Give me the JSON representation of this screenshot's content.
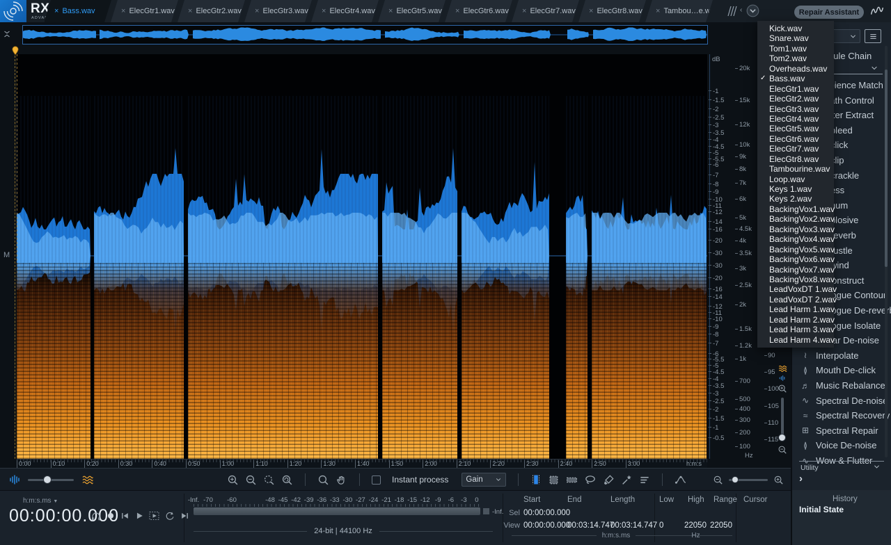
{
  "app": {
    "logo_text": "RX",
    "logo_sub": "ADVANCED",
    "repair_assistant_label": "Repair Assistant"
  },
  "tabs": [
    {
      "label": "Bass.wav",
      "active": true
    },
    {
      "label": "ElecGtr1.wav",
      "active": false
    },
    {
      "label": "ElecGtr2.wav",
      "active": false
    },
    {
      "label": "ElecGtr3.wav",
      "active": false
    },
    {
      "label": "ElecGtr4.wav",
      "active": false
    },
    {
      "label": "ElecGtr5.wav",
      "active": false
    },
    {
      "label": "ElecGtr6.wav",
      "active": false
    },
    {
      "label": "ElecGtr7.wav",
      "active": false
    },
    {
      "label": "ElecGtr8.wav",
      "active": false
    },
    {
      "label": "Tambou…e.wav",
      "active": false
    }
  ],
  "file_menu": {
    "selected": "Bass.wav",
    "items": [
      "Kick.wav",
      "Snare.wav",
      "Tom1.wav",
      "Tom2.wav",
      "Overheads.wav",
      "Bass.wav",
      "ElecGtr1.wav",
      "ElecGtr2.wav",
      "ElecGtr3.wav",
      "ElecGtr4.wav",
      "ElecGtr5.wav",
      "ElecGtr6.wav",
      "ElecGtr7.wav",
      "ElecGtr8.wav",
      "Tambourine.wav",
      "Loop.wav",
      "Keys 1.wav",
      "Keys 2.wav",
      "BackingVox1.wav",
      "BackingVox2.wav",
      "BackingVox3.wav",
      "BackingVox4.wav",
      "BackingVox5.wav",
      "BackingVox6.wav",
      "BackingVox7.wav",
      "BackingVox8.wav",
      "LeadVoxDT 1.wav",
      "LeadVoxDT 2.wav",
      "Lead Harm 1.wav",
      "Lead Harm 2.wav",
      "Lead Harm 3.wav",
      "Lead Harm 4.wav"
    ]
  },
  "editor": {
    "channel_label": "M",
    "db_axis_unit": "dB",
    "db_ticks": [
      1,
      1.5,
      2,
      2.5,
      3,
      3.5,
      4,
      4.5,
      5,
      5.5,
      6,
      7,
      8,
      9,
      10,
      11,
      12,
      14,
      16,
      20,
      30
    ],
    "db_bottom_first": 0.5,
    "freq_axis_unit": "Hz",
    "freq_ticks": [
      {
        "label": "20k",
        "hz": 20000
      },
      {
        "label": "15k",
        "hz": 15000
      },
      {
        "label": "12k",
        "hz": 12000
      },
      {
        "label": "10k",
        "hz": 10000
      },
      {
        "label": "9k",
        "hz": 9000
      },
      {
        "label": "8k",
        "hz": 8000
      },
      {
        "label": "7k",
        "hz": 7000
      },
      {
        "label": "6k",
        "hz": 6000
      },
      {
        "label": "5k",
        "hz": 5000
      },
      {
        "label": "4.5k",
        "hz": 4500
      },
      {
        "label": "4k",
        "hz": 4000
      },
      {
        "label": "3.5k",
        "hz": 3500
      },
      {
        "label": "3k",
        "hz": 3000
      },
      {
        "label": "2.5k",
        "hz": 2500
      },
      {
        "label": "2k",
        "hz": 2000
      },
      {
        "label": "1.5k",
        "hz": 1500
      },
      {
        "label": "1.2k",
        "hz": 1200
      },
      {
        "label": "1k",
        "hz": 1000
      },
      {
        "label": "700",
        "hz": 700
      },
      {
        "label": "500",
        "hz": 500
      },
      {
        "label": "400",
        "hz": 400
      },
      {
        "label": "300",
        "hz": 300
      },
      {
        "label": "200",
        "hz": 200
      },
      {
        "label": "100",
        "hz": 100
      }
    ],
    "color_scale_ticks": [
      "90",
      "95",
      "100",
      "105",
      "110",
      "115"
    ],
    "time_ticks": [
      "0:00",
      "0:10",
      "0:20",
      "0:30",
      "0:40",
      "0:50",
      "1:00",
      "1:10",
      "1:20",
      "1:30",
      "1:40",
      "1:50",
      "2:00",
      "2:10",
      "2:20",
      "2:30",
      "2:40",
      "2:50",
      "3:00"
    ],
    "time_axis_unit": "h:m:s"
  },
  "toolbar": {
    "instant_process_label": "Instant process",
    "process_selector_value": "Gain"
  },
  "transport": {
    "time_format_label": "h:m:s.ms",
    "time_display": "00:00:00.000"
  },
  "meter": {
    "scale_labels": [
      "-Inf.",
      "-70",
      "-60",
      "-48",
      "-45",
      "-42",
      "-39",
      "-36",
      "-33",
      "-30",
      "-27",
      "-24",
      "-21",
      "-18",
      "-15",
      "-12",
      "-9",
      "-6",
      "-3",
      "0"
    ],
    "right_label": "-Inf.",
    "format_info": "24-bit | 44100 Hz"
  },
  "selection_info": {
    "time_cols": [
      "Start",
      "End",
      "Length"
    ],
    "freq_cols": [
      "Low",
      "High",
      "Range"
    ],
    "cursor_col": "Cursor",
    "sel_row_label": "Sel",
    "view_row_label": "View",
    "sel_start": "00:00:00.000",
    "view_start": "00:00:00.000",
    "view_end": "00:03:14.747",
    "view_length": "00:03:14.747",
    "view_low": "0",
    "view_high": "22050",
    "view_range": "22050",
    "time_unit": "h:m:s.ms",
    "freq_unit": "Hz"
  },
  "history": {
    "title": "History",
    "items": [
      "Initial State"
    ]
  },
  "sidebar": {
    "module_chain_label": "Module Chain",
    "utility_label": "Utility",
    "modules": [
      {
        "label": "Ambience Match",
        "icon": "ambience-match-icon"
      },
      {
        "label": "Breath Control",
        "icon": "breath-control-icon"
      },
      {
        "label": "Center Extract",
        "icon": "center-extract-icon"
      },
      {
        "label": "De-bleed",
        "icon": "de-bleed-icon"
      },
      {
        "label": "De-click",
        "icon": "de-click-icon"
      },
      {
        "label": "De-clip",
        "icon": "de-clip-icon"
      },
      {
        "label": "De-crackle",
        "icon": "de-crackle-icon"
      },
      {
        "label": "De-ess",
        "icon": "de-ess-icon"
      },
      {
        "label": "De-hum",
        "icon": "de-hum-icon"
      },
      {
        "label": "De-plosive",
        "icon": "de-plosive-icon"
      },
      {
        "label": "De-reverb",
        "icon": "de-reverb-icon"
      },
      {
        "label": "De-rustle",
        "icon": "de-rustle-icon"
      },
      {
        "label": "De-wind",
        "icon": "de-wind-icon"
      },
      {
        "label": "Deconstruct",
        "icon": "deconstruct-icon"
      },
      {
        "label": "Dialogue Contour",
        "icon": "dialogue-contour-icon"
      },
      {
        "label": "Dialogue De-reverb",
        "icon": "dialogue-de-reverb-icon"
      },
      {
        "label": "Dialogue Isolate",
        "icon": "dialogue-isolate-icon"
      },
      {
        "label": "Guitar De-noise",
        "icon": "guitar-de-noise-icon"
      },
      {
        "label": "Interpolate",
        "icon": "interpolate-icon"
      },
      {
        "label": "Mouth De-click",
        "icon": "mouth-de-click-icon"
      },
      {
        "label": "Music Rebalance",
        "icon": "music-rebalance-icon"
      },
      {
        "label": "Spectral De-noise",
        "icon": "spectral-de-noise-icon"
      },
      {
        "label": "Spectral Recovery",
        "icon": "spectral-recovery-icon"
      },
      {
        "label": "Spectral Repair",
        "icon": "spectral-repair-icon"
      },
      {
        "label": "Voice De-noise",
        "icon": "voice-de-noise-icon"
      },
      {
        "label": "Wow & Flutter",
        "icon": "wow-flutter-icon"
      }
    ]
  }
}
